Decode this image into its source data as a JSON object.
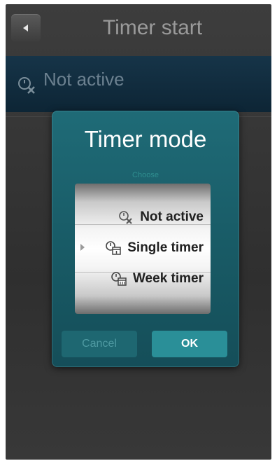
{
  "header": {
    "title": "Timer start",
    "back_icon": "back-arrow-icon"
  },
  "status": {
    "text": "Not active",
    "icon": "timer-off-icon"
  },
  "dialog": {
    "title": "Timer mode",
    "subtitle": "Choose",
    "options": [
      {
        "label": "Not active",
        "icon": "timer-off-icon"
      },
      {
        "label": "Single timer",
        "icon": "single-timer-icon",
        "selected": true
      },
      {
        "label": "Week timer",
        "icon": "week-timer-icon"
      }
    ],
    "cancel_label": "Cancel",
    "ok_label": "OK"
  },
  "colors": {
    "accent": "#2a8f98",
    "dialog": "#1f6b77",
    "status_row": "#163448"
  }
}
